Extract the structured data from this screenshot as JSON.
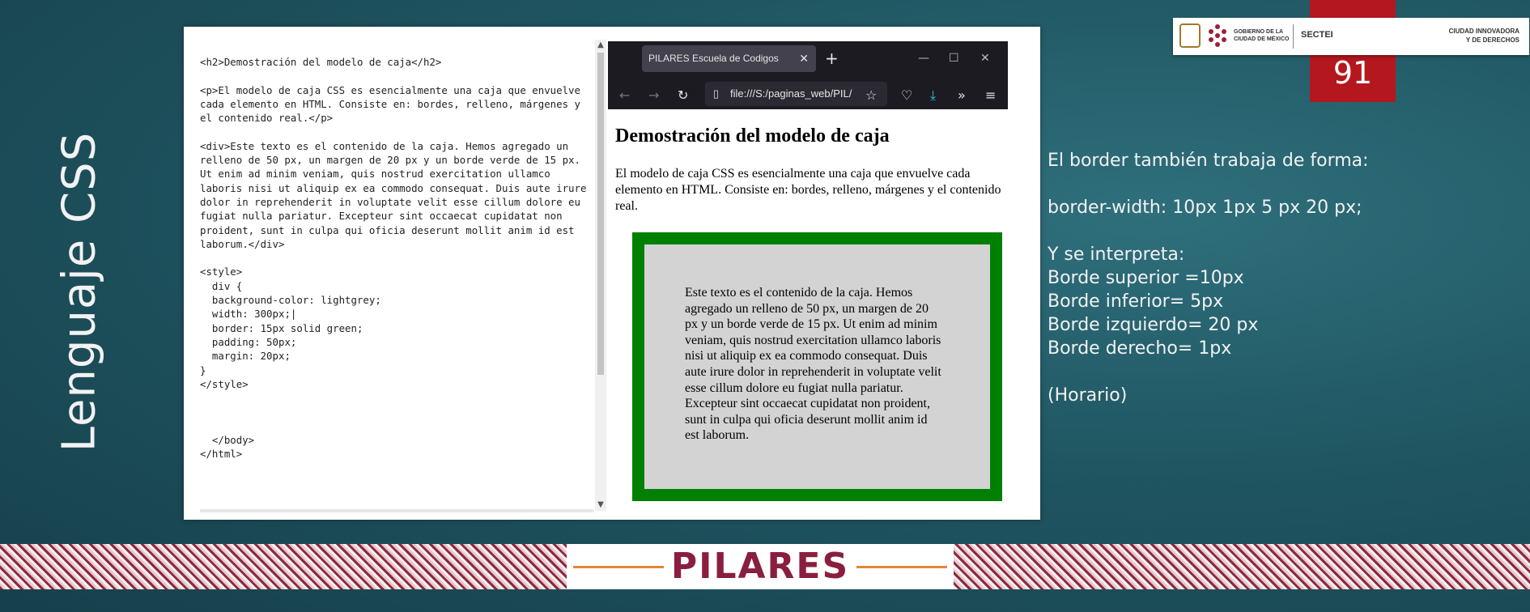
{
  "slide": {
    "vertical_title": "Lenguaje CSS",
    "page_number": "91"
  },
  "editor": {
    "code": "<h2>Demostración del modelo de caja</h2>\n\n<p>El modelo de caja CSS es esencialmente una caja que envuelve cada elemento en HTML. Consiste en: bordes, relleno, márgenes y el contenido real.</p>\n\n<div>Este texto es el contenido de la caja. Hemos agregado un relleno de 50 px, un margen de 20 px y un borde verde de 15 px. Ut enim ad minim veniam, quis nostrud exercitation ullamco laboris nisi ut aliquip ex ea commodo consequat. Duis aute irure dolor in reprehenderit in voluptate velit esse cillum dolore eu fugiat nulla pariatur. Excepteur sint occaecat cupidatat non proident, sunt in culpa qui oficia deserunt mollit anim id est laborum.</div>\n\n<style>\n  div {\n  background-color: lightgrey;\n  width: 300px;|\n  border: 15px solid green;\n  padding: 50px;\n  margin: 20px;\n}\n</style>\n\n\n\n  </body>\n</html>"
  },
  "browser": {
    "tab_title": "PILARES Escuela de Codigos",
    "url": "file:///S:/paginas_web/PIL/",
    "heading": "Demostración del modelo de caja",
    "paragraph": "El modelo de caja CSS es esencialmente una caja que envuelve cada elemento en HTML. Consiste en: bordes, relleno, márgenes y el contenido real.",
    "box_text": "Este texto es el contenido de la caja. Hemos agregado un relleno de 50 px, un margen de 20 px y un borde verde de 15 px. Ut enim ad minim veniam, quis nostrud exercitation ullamco laboris nisi ut aliquip ex ea commodo consequat. Duis aute irure dolor in reprehenderit in voluptate velit esse cillum dolore eu fugiat nulla pariatur. Excepteur sint occaecat cupidatat non proident, sunt in culpa qui oficia deserunt mollit anim id est laborum."
  },
  "explanation": {
    "lines": [
      "El border también trabaja de forma:",
      "",
      "border-width: 10px 1px 5 px 20 px;",
      "",
      "Y se interpreta:",
      "Borde superior =10px",
      "Borde inferior= 5px",
      "Borde izquierdo= 20 px",
      "Borde derecho= 1px",
      "",
      "(Horario)"
    ]
  },
  "header_logo": {
    "gov_line1": "GOBIERNO DE LA",
    "gov_line2": "CIUDAD DE MÉXICO",
    "sectei": "SECTEI",
    "ciudad_line1": "CIUDAD INNOVADORA",
    "ciudad_line2": "Y DE DERECHOS"
  },
  "footer": {
    "brand": "PILARES"
  },
  "colors": {
    "background": "#1f5662",
    "page_number_bg": "#b4171e",
    "box_border": "#008000",
    "box_bg": "#d3d3d3",
    "brand": "#8a1e3f"
  }
}
